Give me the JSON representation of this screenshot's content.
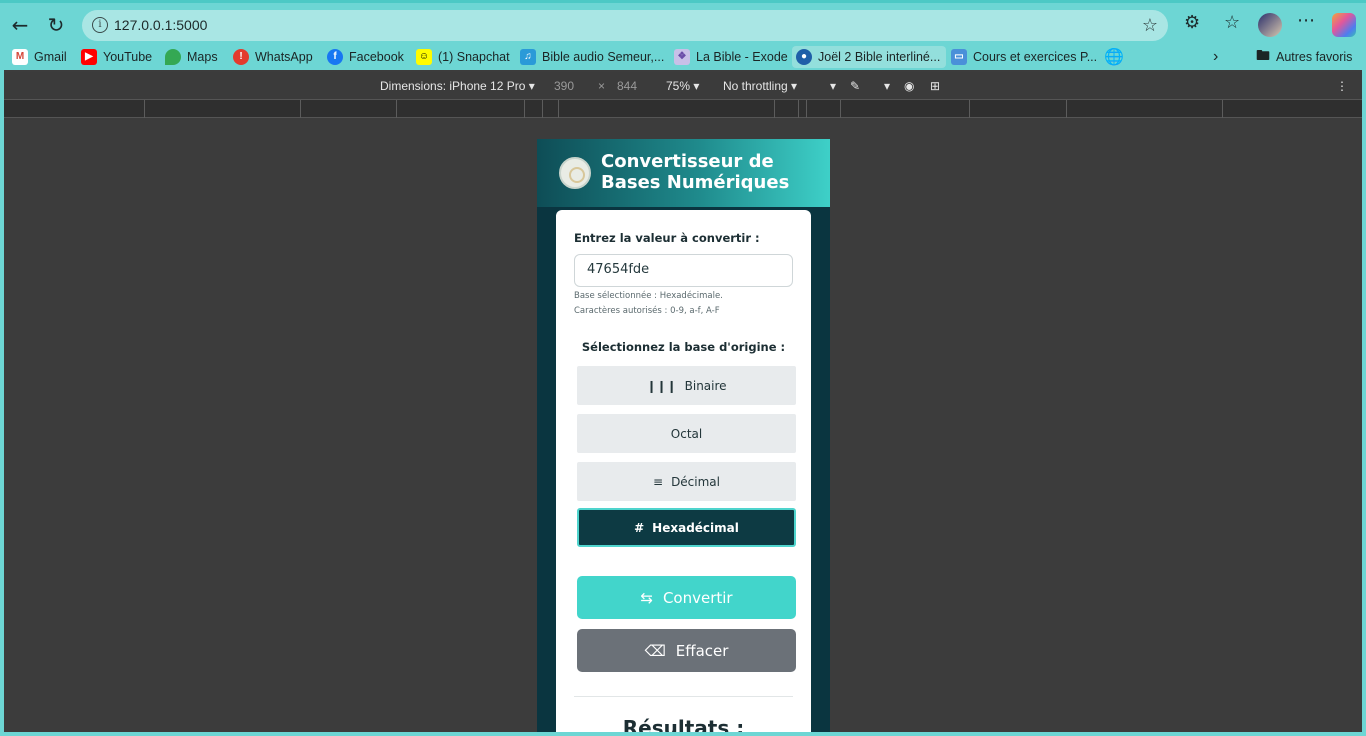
{
  "browser": {
    "url": "127.0.0.1:5000",
    "icons": [
      "back-icon",
      "refresh-icon",
      "info-icon",
      "star-icon",
      "extensions-icon",
      "favorites-icon",
      "profile-avatar",
      "more-icon",
      "copilot-icon"
    ]
  },
  "bookmarks": [
    {
      "label": "Gmail",
      "icon": "gmail-icon"
    },
    {
      "label": "YouTube",
      "icon": "youtube-icon"
    },
    {
      "label": "Maps",
      "icon": "maps-icon"
    },
    {
      "label": "WhatsApp",
      "icon": "whatsapp-icon"
    },
    {
      "label": "Facebook",
      "icon": "facebook-icon"
    },
    {
      "label": "(1) Snapchat",
      "icon": "snapchat-icon"
    },
    {
      "label": "Bible audio Semeur,...",
      "icon": "bible-audio-icon"
    },
    {
      "label": "La Bible - Exode",
      "icon": "bible-icon"
    },
    {
      "label": "Joël 2 Bible interliné...",
      "icon": "interlinear-icon"
    },
    {
      "label": "Cours et exercices P...",
      "icon": "course-icon"
    },
    {
      "label": "",
      "icon": "globe-icon"
    }
  ],
  "bookmarks_other": "Autres favoris",
  "devtools": {
    "dimensions": "Dimensions: iPhone 12 Pro",
    "width": "390",
    "times": "×",
    "height": "844",
    "zoom": "75%",
    "throttling": "No throttling"
  },
  "app": {
    "title": "Convertisseur de Bases Numériques",
    "input_label": "Entrez la valeur à convertir :",
    "input_value": "47654fde",
    "hint_base": "Base sélectionnée : Hexadécimale.",
    "hint_chars": "Caractères autorisés : 0-9, a-f, A-F",
    "select_label": "Sélectionnez la base d'origine :",
    "bases": [
      {
        "label": "Binaire",
        "icon": "barcode-icon",
        "active": false
      },
      {
        "label": "Octal",
        "icon": "",
        "active": false
      },
      {
        "label": "Décimal",
        "icon": "list-ordered-icon",
        "active": false
      },
      {
        "label": "Hexadécimal",
        "icon": "hash-icon",
        "active": true
      }
    ],
    "convert_label": "Convertir",
    "clear_label": "Effacer",
    "results_title": "Résultats :"
  }
}
